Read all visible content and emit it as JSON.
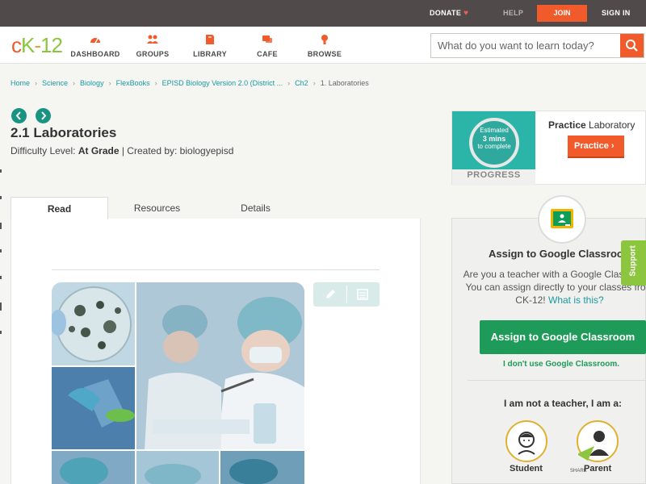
{
  "topbar": {
    "donate": "DONATE",
    "help": "HELP",
    "join": "JOIN",
    "signin": "SIGN IN"
  },
  "brand": {
    "logo_c": "c",
    "logo_k": "K",
    "logo_dash": "-",
    "logo_num": "12",
    "accent": "#f15a2b",
    "green": "#8cc63f",
    "teal": "#1a9aa0"
  },
  "nav": {
    "items": [
      {
        "label": "DASHBOARD",
        "icon": "dashboard-icon"
      },
      {
        "label": "GROUPS",
        "icon": "groups-icon"
      },
      {
        "label": "LIBRARY",
        "icon": "library-icon"
      },
      {
        "label": "CAFE",
        "icon": "cafe-icon"
      },
      {
        "label": "BROWSE",
        "icon": "browse-icon"
      }
    ]
  },
  "search": {
    "placeholder": "What do you want to learn today?"
  },
  "breadcrumb": {
    "items": [
      "Home",
      "Science",
      "Biology",
      "FlexBooks",
      "EPISD Biology Version 2.0 (District ...",
      "Ch2"
    ],
    "current": "1. Laboratories"
  },
  "page": {
    "title": "2.1 Laboratories",
    "difficulty_label": "Difficulty Level:",
    "difficulty_value": "At Grade",
    "created_by": "| Created by: biologyepisd"
  },
  "tabs": [
    {
      "label": "Read",
      "active": true
    },
    {
      "label": "Resources",
      "active": false
    },
    {
      "label": "Details",
      "active": false
    }
  ],
  "practice": {
    "estimated_line1": "Estimated",
    "estimated_line2": "3 mins",
    "estimated_line3": "to complete",
    "progress": "PROGRESS",
    "title_bold": "Practice",
    "title_rest": "Laboratory",
    "button": "Practice"
  },
  "classroom": {
    "title": "Assign to Google Classroom",
    "desc": "Are you a teacher with a Google Classroom? You can assign directly to your classes from CK-12!",
    "what_is_this": "What is this?",
    "button": "Assign to Google Classroom",
    "no_link": "I don't use Google Classroom.",
    "iam": "I am not a teacher, I am a:",
    "student": "Student",
    "parent": "Parent",
    "share": "SHARE"
  },
  "support": "Support"
}
